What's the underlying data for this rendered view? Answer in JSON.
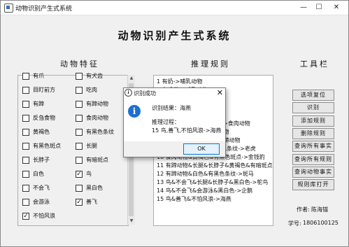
{
  "window": {
    "title": "动物识别产生式系统",
    "minimize": "—",
    "maximize": "☐",
    "close": "✕"
  },
  "heading": "动物识别产生式系统",
  "features": {
    "title": "动物特征",
    "items": [
      {
        "label": "有爪",
        "checked": false
      },
      {
        "label": "有犬齿",
        "checked": false
      },
      {
        "label": "目盯前方",
        "checked": false
      },
      {
        "label": "吃肉",
        "checked": false
      },
      {
        "label": "有蹄",
        "checked": false
      },
      {
        "label": "有蹄动物",
        "checked": false
      },
      {
        "label": "反刍食物",
        "checked": false
      },
      {
        "label": "食肉动物",
        "checked": false
      },
      {
        "label": "黄褐色",
        "checked": false
      },
      {
        "label": "有黑色条纹",
        "checked": false
      },
      {
        "label": "有黑色斑点",
        "checked": false
      },
      {
        "label": "长腿",
        "checked": false
      },
      {
        "label": "长脖子",
        "checked": false
      },
      {
        "label": "有暗斑点",
        "checked": false
      },
      {
        "label": "白色",
        "checked": false
      },
      {
        "label": "鸟",
        "checked": true
      },
      {
        "label": "不会飞",
        "checked": false
      },
      {
        "label": "黑白色",
        "checked": false
      },
      {
        "label": "会游泳",
        "checked": false
      },
      {
        "label": "善飞",
        "checked": true
      },
      {
        "label": "不怕风浪",
        "checked": true
      }
    ]
  },
  "rules": {
    "title": "推理规则",
    "lines": [
      "1  有奶->哺乳动物",
      "2  有毛发->哺乳动物",
      "3  有羽毛->鸟",
      "4  会飞&下蛋->鸟",
      "5  吃肉->食肉动物",
      "6  有犬齿&有爪&目盯前方->食肉动物",
      "7  哺乳动物&有蹄->有蹄动物",
      "8  哺乳动物&反刍食物->有蹄动物",
      "9  食肉动物&黄褐色&有黑色条纹->老虎",
      "10 食肉动物&黄褐色&有黑色斑点->金钱豹",
      "11 有蹄动物&长腿&长脖子&黄褐色&有暗斑点->长颈鹿",
      "12 有蹄动物&白色&有黑色条纹->斑马",
      "13 鸟&不会飞&长腿&长脖子&黑白色->鸵鸟",
      "14 鸟&不会飞&会游泳&黑白色->企鹅",
      "15 鸟&善飞&不怕风浪->海燕"
    ]
  },
  "tools": {
    "title": "工具栏",
    "buttons": [
      "选项复位",
      "识别",
      "添加规则",
      "删除规则",
      "查询所有事实",
      "查询所有规则",
      "查询动物事实",
      "规则库打开"
    ]
  },
  "author": {
    "name_label": "作者:",
    "name": "陈海锚",
    "id_label": "学号:",
    "id": "1806100125"
  },
  "dialog": {
    "title": "识别成功",
    "result_line": "识别结果：海燕",
    "process_label": "推理过程：",
    "process_text": "15 鸟,善飞,不怕风浪->海燕",
    "ok": "OK",
    "close": "✕"
  },
  "colors": {
    "info_icon": "#1d6fd0",
    "ok_border": "#0078d7"
  }
}
